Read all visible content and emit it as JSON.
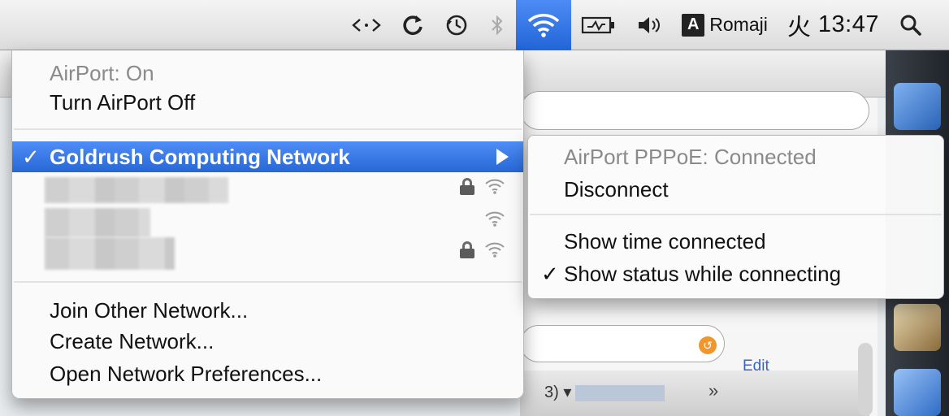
{
  "menubar": {
    "items": [
      {
        "name": "script-menu-icon",
        "glyph": "‹·›"
      },
      {
        "name": "sync-icon",
        "glyph": "sync"
      },
      {
        "name": "time-machine-icon",
        "glyph": "clock"
      },
      {
        "name": "bluetooth-icon",
        "glyph": "bluetooth"
      },
      {
        "name": "wifi-icon",
        "glyph": "wifi"
      },
      {
        "name": "battery-icon",
        "glyph": "battery"
      },
      {
        "name": "volume-icon",
        "glyph": "speaker"
      }
    ],
    "input_method_label": "Romaji",
    "input_method_icon": "A",
    "clock_day": "火",
    "clock_time": "13:47",
    "spotlight_icon": "search-icon",
    "accent_color": "#2f73e6"
  },
  "airport_menu": {
    "status": "AirPort: On",
    "toggle_label": "Turn AirPort Off",
    "connected_network": "Goldrush Computing Network",
    "networks": [
      {
        "label": "",
        "locked": true,
        "signal": "wifi"
      },
      {
        "label": "",
        "locked": false,
        "signal": "wifi"
      },
      {
        "label": "",
        "locked": true,
        "signal": "wifi"
      }
    ],
    "join_other": "Join Other Network...",
    "create_network": "Create Network...",
    "open_prefs": "Open Network Preferences..."
  },
  "submenu": {
    "status": "AirPort PPPoE: Connected",
    "disconnect": "Disconnect",
    "show_time": "Show time connected",
    "show_status": "Show status while connecting",
    "show_status_checked": true
  },
  "background": {
    "edit_link": "Edit",
    "dropdown_fragment": "3) ▾",
    "overflow_glyph": "»"
  }
}
